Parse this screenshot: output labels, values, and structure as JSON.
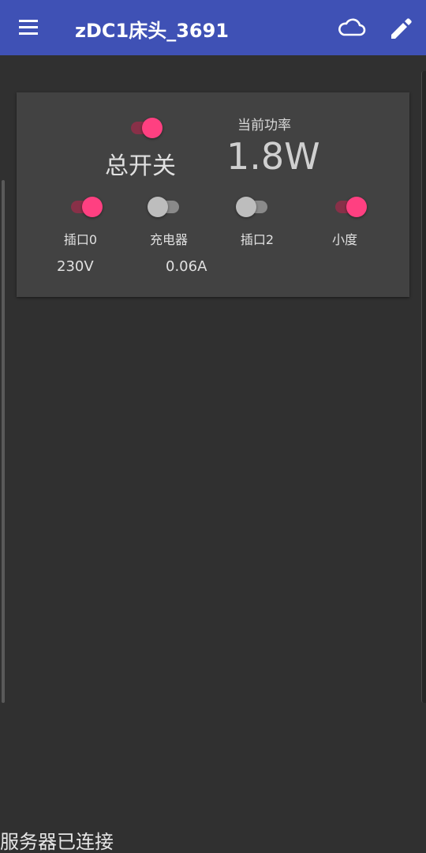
{
  "header": {
    "title": "zDC1床头_3691",
    "menu_icon": "hamburger-menu-icon",
    "cloud_icon": "cloud-outline-icon",
    "edit_icon": "pencil-icon",
    "background_color": "#3f51b5"
  },
  "device": {
    "master": {
      "label": "总开关",
      "on": true
    },
    "power": {
      "label": "当前功率",
      "value": "1.8W"
    },
    "plugs": [
      {
        "label": "插口0",
        "on": true
      },
      {
        "label": "充电器",
        "on": false
      },
      {
        "label": "插口2",
        "on": false
      },
      {
        "label": "小度",
        "on": true
      }
    ],
    "voltage": "230V",
    "current": "0.06A"
  },
  "status": {
    "text": "服务器已连接"
  },
  "colors": {
    "accent": "#ff4081",
    "background": "#303030",
    "card": "#424242"
  }
}
